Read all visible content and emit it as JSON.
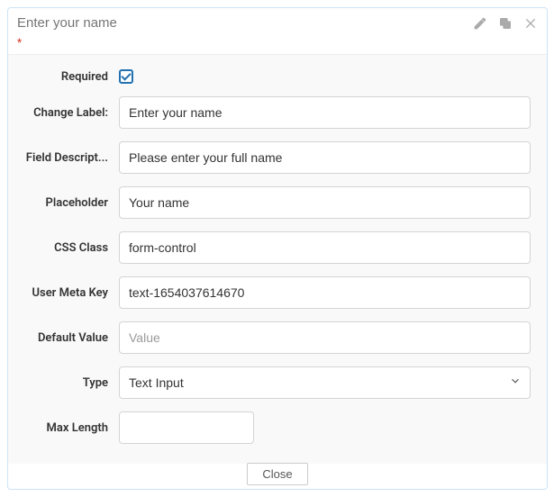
{
  "header": {
    "title_value": "",
    "title_placeholder": "Enter your name",
    "required_indicator": "*"
  },
  "labels": {
    "required": "Required",
    "change_label": "Change Label:",
    "field_description": "Field Descript...",
    "placeholder": "Placeholder",
    "css_class": "CSS Class",
    "user_meta_key": "User Meta Key",
    "default_value": "Default Value",
    "type": "Type",
    "max_length": "Max Length"
  },
  "fields": {
    "required_checked": true,
    "change_label": "Enter your name",
    "field_description": "Please enter your full name",
    "placeholder": "Your name",
    "css_class": "form-control",
    "user_meta_key": "text-1654037614670",
    "default_value": "",
    "default_value_placeholder": "Value",
    "type": "Text Input",
    "max_length": ""
  },
  "footer": {
    "close": "Close"
  }
}
